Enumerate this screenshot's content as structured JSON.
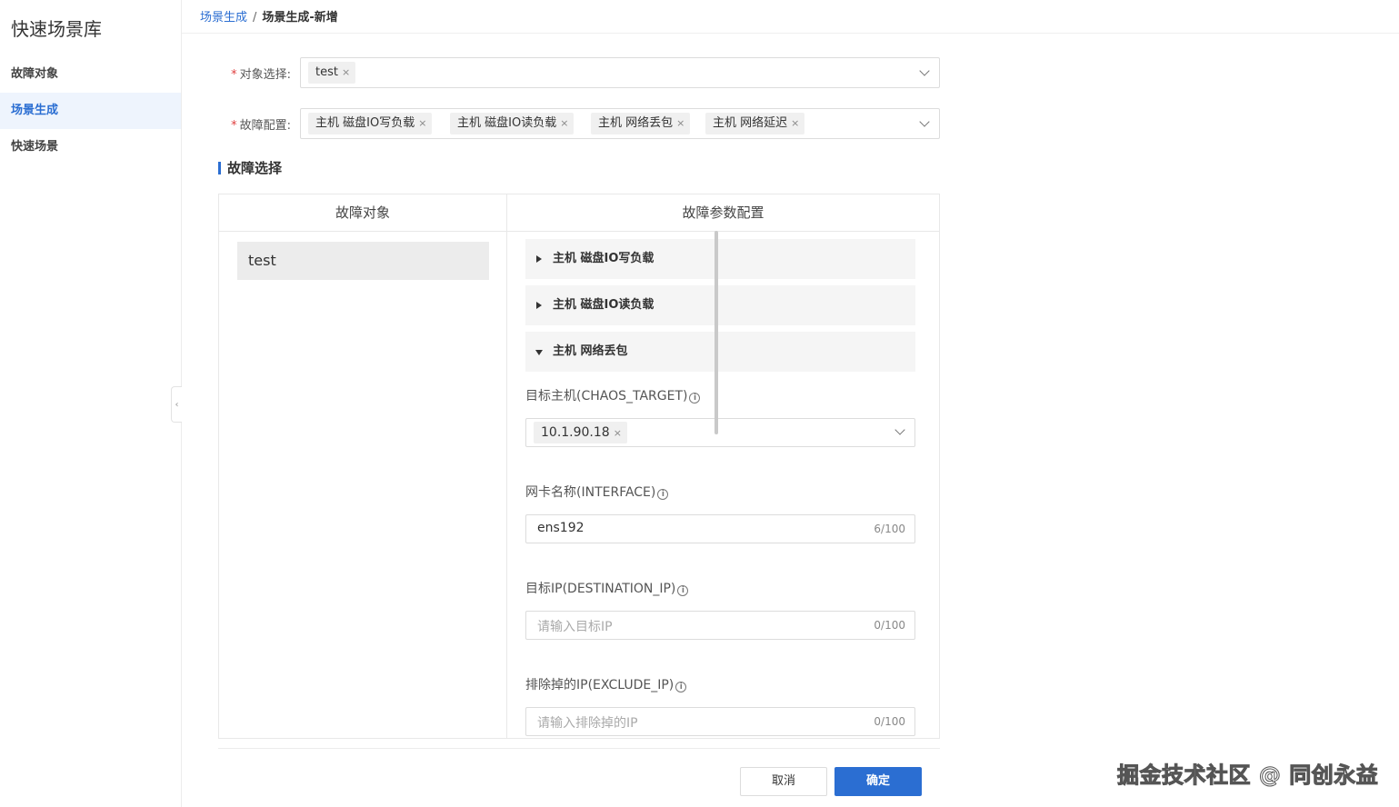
{
  "sidebar": {
    "title": "快速场景库",
    "items": [
      {
        "label": "故障对象"
      },
      {
        "label": "场景生成"
      },
      {
        "label": "快速场景"
      }
    ],
    "collapse_glyph": "‹"
  },
  "breadcrumb": {
    "parent": "场景生成",
    "separator": "/",
    "current": "场景生成-新增"
  },
  "form": {
    "object_select": {
      "label": "对象选择:",
      "tags": [
        "test"
      ]
    },
    "fault_config": {
      "label": "故障配置:",
      "tags": [
        "主机 磁盘IO写负载",
        "主机 磁盘IO读负载",
        "主机 网络丢包",
        "主机 网络延迟"
      ]
    },
    "required_mark": "*",
    "tag_close": "×"
  },
  "section": {
    "title": "故障选择",
    "left_header": "故障对象",
    "right_header": "故障参数配置",
    "objects": [
      "test"
    ],
    "collapse_items": [
      {
        "label": "主机 磁盘IO写负载",
        "expanded": false
      },
      {
        "label": "主机 磁盘IO读负载",
        "expanded": false
      },
      {
        "label": "主机 网络丢包",
        "expanded": true
      }
    ],
    "params": {
      "target": {
        "label": "目标主机(CHAOS_TARGET)",
        "tags": [
          "10.1.90.18"
        ]
      },
      "interface": {
        "label": "网卡名称(INTERFACE)",
        "value": "ens192",
        "count": "6/100"
      },
      "destination_ip": {
        "label": "目标IP(DESTINATION_IP)",
        "placeholder": "请输入目标IP",
        "count": "0/100"
      },
      "exclude_ip": {
        "label": "排除掉的IP(EXCLUDE_IP)",
        "placeholder": "请输入排除掉的IP",
        "count": "0/100"
      }
    },
    "info_glyph": "i"
  },
  "actions": {
    "cancel": "取消",
    "ok": "确定"
  },
  "watermark": "掘金技术社区 @ 同创永益",
  "colors": {
    "accent": "#2b6ed2",
    "required": "#e04040"
  }
}
